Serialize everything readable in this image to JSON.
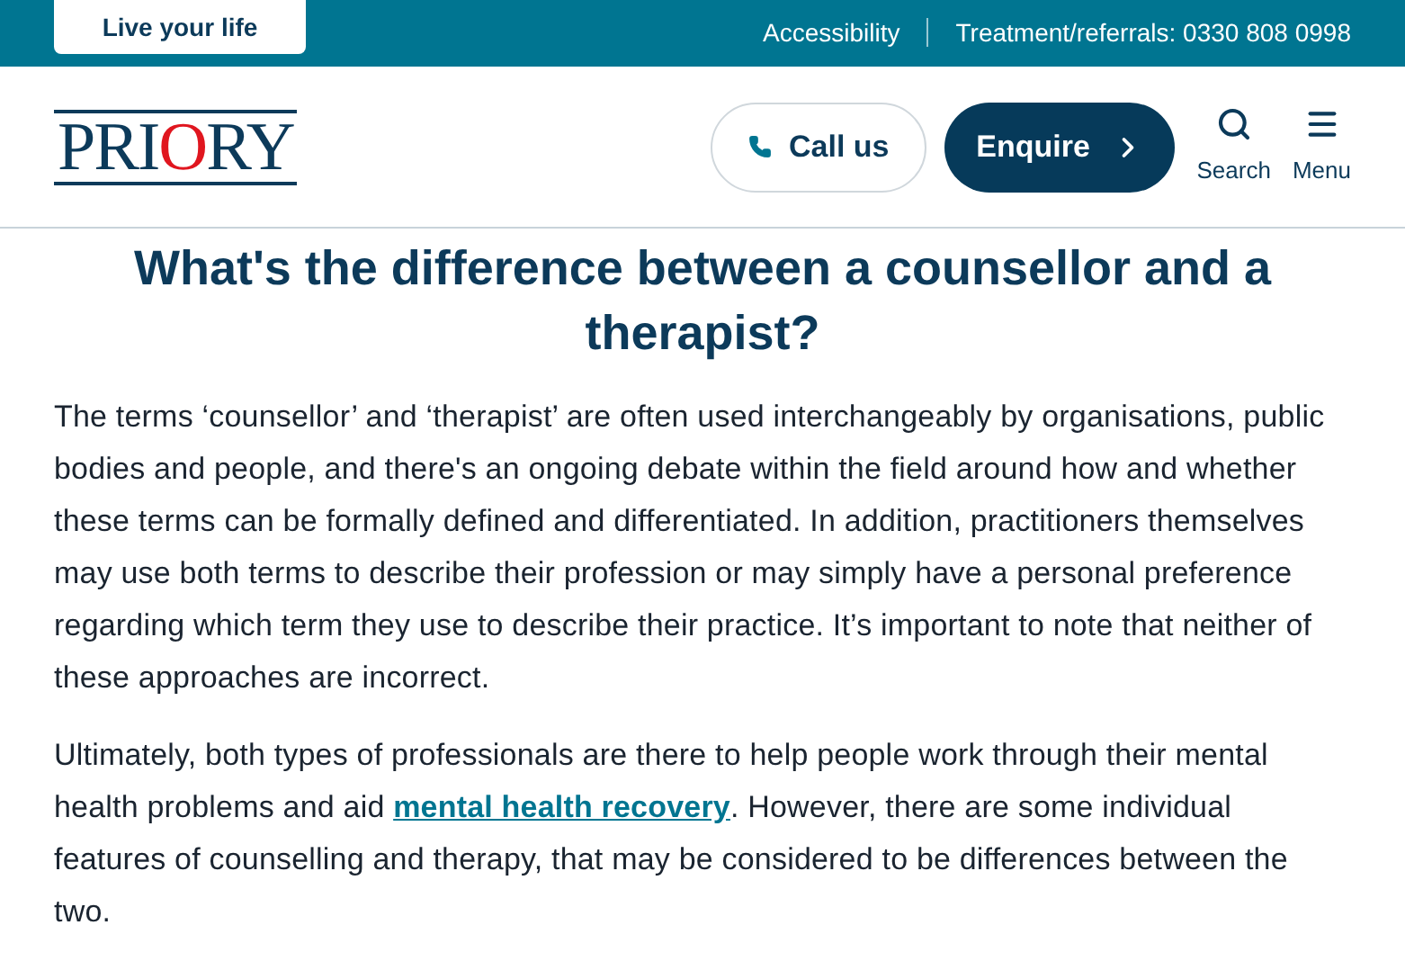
{
  "top_bar": {
    "tab": "Live your life",
    "links": [
      "Accessibility",
      "Treatment/referrals: 0330 808 0998"
    ]
  },
  "header": {
    "logo": [
      {
        "text": "PRI",
        "accent": false
      },
      {
        "text": "O",
        "accent": true
      },
      {
        "text": "RY",
        "accent": false
      }
    ],
    "call_button": "Call us",
    "enquire_button": "Enquire",
    "icons": [
      {
        "kind": "search",
        "label": "Search"
      },
      {
        "kind": "menu",
        "label": "Menu"
      }
    ]
  },
  "article": {
    "heading": "What's the difference between a counsellor and a therapist?",
    "paragraphs": [
      [
        {
          "text": "The terms ‘counsellor’ and ‘therapist’ are often used interchangeably by organisations, public bodies and people, and there's an ongoing debate within the field around how and whether these terms can be formally defined and differentiated. In addition, practitioners themselves may use both terms to describe their profession or may simply have a personal preference regarding which term they use to describe their practice. It’s important to note that neither of these approaches are incorrect.",
          "link": false
        }
      ],
      [
        {
          "text": "Ultimately, both types of professionals are there to help people work through their mental health problems and aid ",
          "link": false
        },
        {
          "text": "mental health recovery",
          "link": true
        },
        {
          "text": ". However, there are some individual features of counselling and therapy, that may be considered to be differences between the two.",
          "link": false
        }
      ]
    ]
  }
}
